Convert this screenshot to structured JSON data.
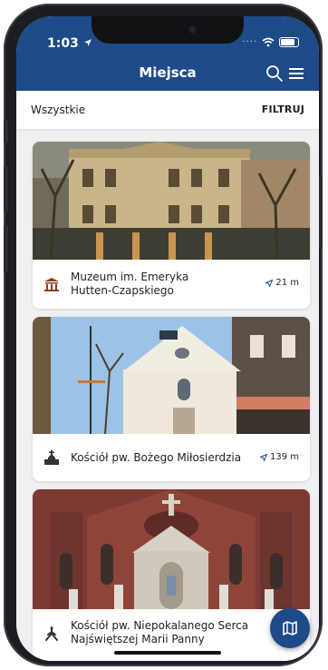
{
  "status_bar": {
    "time": "1:03"
  },
  "header": {
    "title": "Miejsca"
  },
  "filter_bar": {
    "left_label": "Wszystkie",
    "right_label": "FILTRUJ"
  },
  "places": [
    {
      "name_line1": "Muzeum im. Emeryka",
      "name_line2": "Hutten-Czapskiego",
      "distance": "21 m",
      "icon": "museum-icon"
    },
    {
      "name_line1": "Kościół pw. Bożego Miłosierdzia",
      "name_line2": "",
      "distance": "139 m",
      "icon": "church-icon"
    },
    {
      "name_line1": "Kościół pw. Niepokalanego Serca",
      "name_line2": "Najświętszej Marii Panny",
      "distance": "",
      "icon": "monument-icon"
    }
  ],
  "colors": {
    "brand": "#1f4a8a",
    "card_bg": "#ffffff",
    "list_bg": "#f0f0f2"
  }
}
